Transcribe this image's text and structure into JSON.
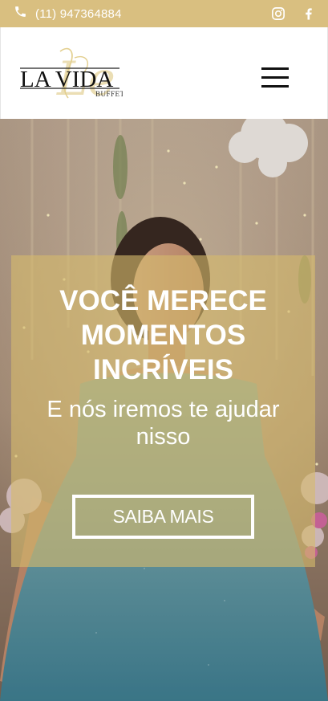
{
  "topbar": {
    "phone": "(11) 947364884",
    "phone_icon": "phone-icon",
    "social_icons": [
      "instagram-icon",
      "facebook-icon"
    ],
    "background_color": "#d9bf80"
  },
  "header": {
    "logo": {
      "main": "LA VIDA",
      "sub": "BUFFET",
      "script": "Le"
    },
    "menu_icon": "hamburger-menu-icon"
  },
  "hero": {
    "title_line1": "VOCÊ MERECE",
    "title_line2": "MOMENTOS",
    "title_line3": "INCRÍVEIS",
    "subtitle_line1": "E nós iremos te ajudar",
    "subtitle_line2": "nisso",
    "cta_label": "SAIBA MAIS",
    "overlay_color": "#d5ba6c"
  }
}
